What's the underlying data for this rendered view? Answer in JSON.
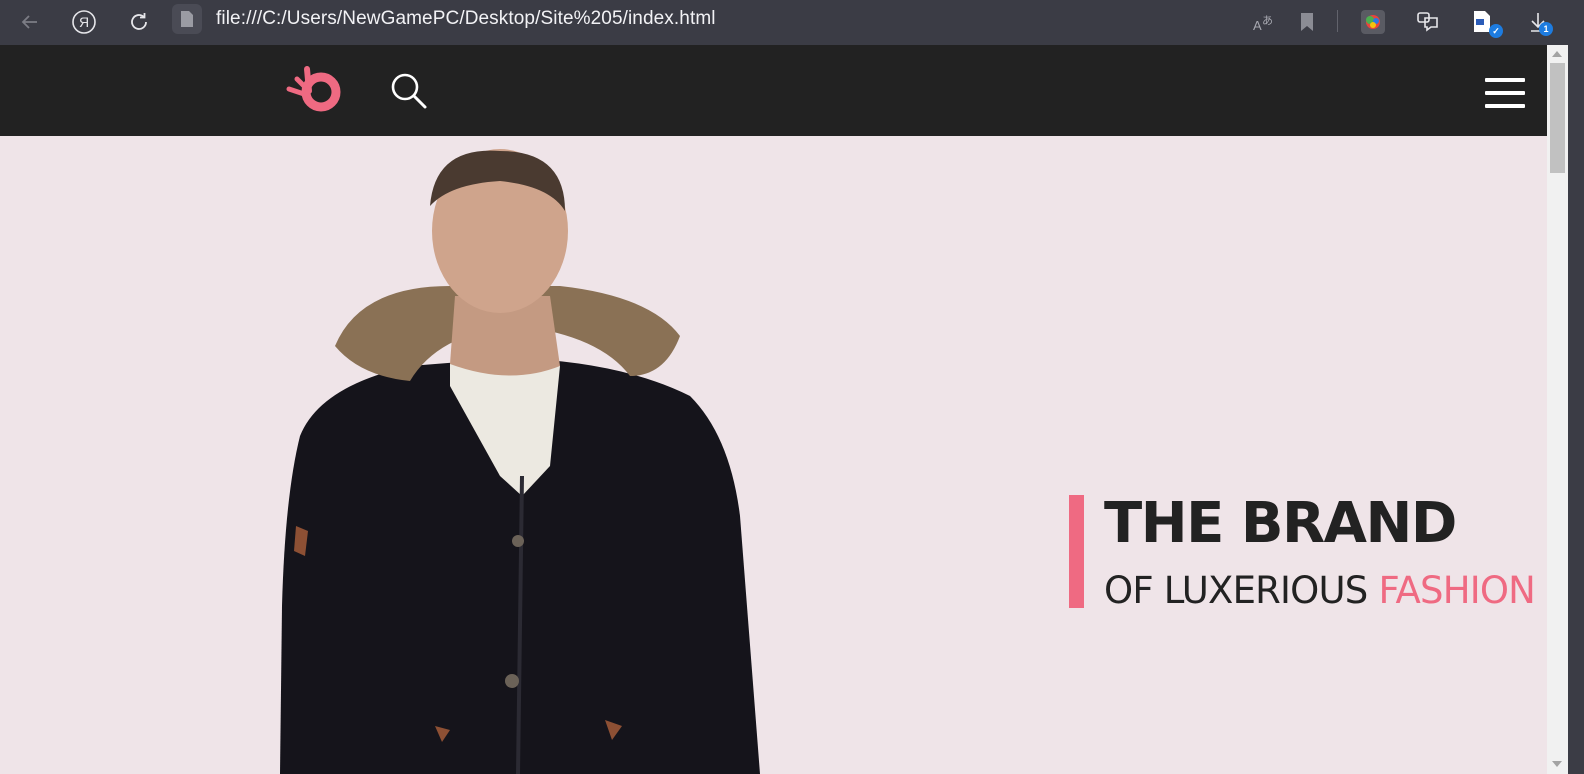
{
  "browser": {
    "url": "file:///C:/Users/NewGamePC/Desktop/Site%205/index.html",
    "downloads_count": "1"
  },
  "site": {
    "brand_color": "#ef6a82",
    "header_bg": "#222222",
    "hero_bg": "#efe4e8",
    "hero": {
      "title": "THE BRAND",
      "subtitle_prefix": "OF LUXERIOUS",
      "subtitle_accent": "FASHION"
    }
  }
}
